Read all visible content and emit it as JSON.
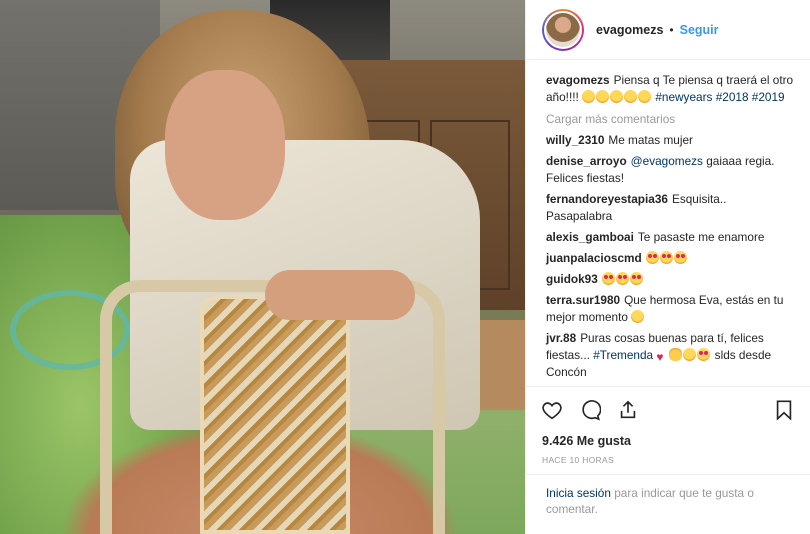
{
  "post": {
    "username": "evagomezs",
    "follow_label": "Seguir",
    "dot": "•",
    "caption": {
      "user": "evagomezs",
      "text": "Piensa q Te piensa q traerá el otro año!!!! ",
      "hashtags": [
        "#newyears",
        "#2018",
        "#2019"
      ]
    },
    "load_more": "Cargar más comentarios",
    "comments": [
      {
        "user": "willy_2310",
        "text": "Me matas mujer"
      },
      {
        "user": "denise_arroyo",
        "mention": "@evagomezs",
        "text": " gaiaaa regia. Felices fiestas!"
      },
      {
        "user": "fernandoreyestapia36",
        "text": "Esquisita.. Pasapalabra"
      },
      {
        "user": "alexis_gamboai",
        "text": "Te pasaste me enamore"
      },
      {
        "user": "juanpalacioscmd",
        "text": ""
      },
      {
        "user": "guidok93",
        "text": ""
      },
      {
        "user": "terra.sur1980",
        "text": "Que hermosa Eva, estás en tu mejor momento "
      },
      {
        "user": "jvr.88",
        "text": "Puras cosas buenas para tí, felices fiestas... ",
        "hashtag": "#Tremenda",
        "after": " slds desde Concón"
      }
    ],
    "likes": "9.426 Me gusta",
    "time": "HACE 10 HORAS",
    "login_link": "Inicia sesión",
    "login_text": " para indicar que te gusta o comentar."
  },
  "icons": [
    "heart-icon",
    "comment-icon",
    "share-icon",
    "bookmark-icon"
  ]
}
